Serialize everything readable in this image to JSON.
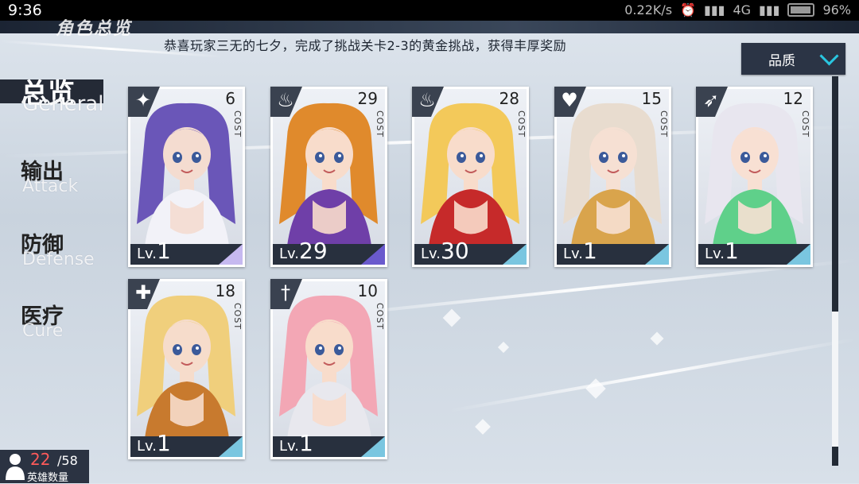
{
  "status_bar": {
    "time": "9:36",
    "speed": "0.22K/s",
    "network": "4G",
    "battery": "96%"
  },
  "header": {
    "title": "角色总览"
  },
  "announcement": "恭喜玩家三无的七夕，完成了挑战关卡2-3的黄金挑战，获得丰厚奖励",
  "quality_filter": {
    "label": "品质"
  },
  "tabs": [
    {
      "cn": "总览",
      "en": "General",
      "active": true
    },
    {
      "cn": "输出",
      "en": "Attack",
      "active": false
    },
    {
      "cn": "防御",
      "en": "Defense",
      "active": false
    },
    {
      "cn": "医疗",
      "en": "Cure",
      "active": false
    }
  ],
  "cost_label": "COST",
  "lv_label": "Lv.",
  "cards": [
    {
      "cost": "6",
      "level": "1",
      "class_icon": "shuriken-icon",
      "accent": "#c6b9f0",
      "hair": "#6a56b8",
      "skin": "#f4dcd0",
      "outfit": "#f2f2f8"
    },
    {
      "cost": "29",
      "level": "29",
      "class_icon": "flame-icon",
      "accent": "#6a5acd",
      "hair": "#e08a2c",
      "skin": "#f8dccb",
      "outfit": "#6f3fa8"
    },
    {
      "cost": "28",
      "level": "30",
      "class_icon": "flame-icon",
      "accent": "#7ac6e0",
      "hair": "#f3c95a",
      "skin": "#f8dccb",
      "outfit": "#c62a2a"
    },
    {
      "cost": "15",
      "level": "1",
      "class_icon": "heart-icon",
      "accent": "#7ac6e0",
      "hair": "#e8dccf",
      "skin": "#f6e0d3",
      "outfit": "#d9a44c"
    },
    {
      "cost": "12",
      "level": "1",
      "class_icon": "bow-icon",
      "accent": "#7ac6e0",
      "hair": "#e8e6ef",
      "skin": "#f8e0d3",
      "outfit": "#5fd08a"
    },
    {
      "cost": "18",
      "level": "1",
      "class_icon": "shield-icon",
      "accent": "#7ac6e0",
      "hair": "#f0cf7c",
      "skin": "#f6dccb",
      "outfit": "#c87a2e"
    },
    {
      "cost": "10",
      "level": "1",
      "class_icon": "sword-icon",
      "accent": "#7ac6e0",
      "hair": "#f3a7b5",
      "skin": "#f8dccb",
      "outfit": "#e8e8ee"
    }
  ],
  "hero_count": {
    "current": "22",
    "total": "/58",
    "label": "英雄数量"
  }
}
